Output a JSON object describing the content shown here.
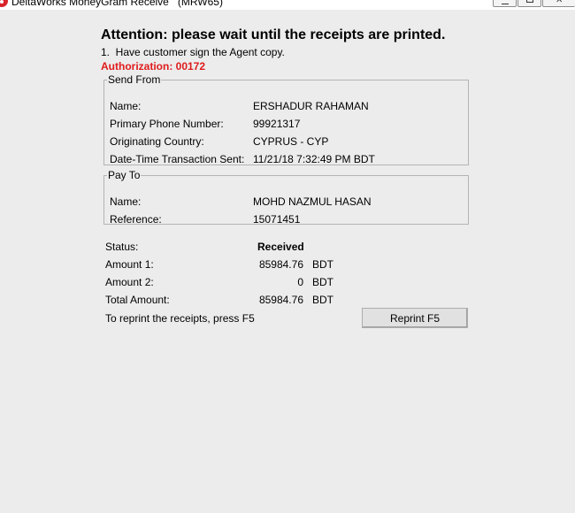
{
  "window": {
    "title": "DeltaWorks MoneyGram Receive   (MRW65)",
    "icon": "moneygram-logo-icon",
    "controls": [
      "minimize-icon",
      "maximize-icon",
      "close-icon"
    ]
  },
  "header": {
    "attention": "Attention: please wait until the receipts are printed.",
    "instruction": "1.  Have customer sign the Agent copy.",
    "authorization": "Authorization: 00172",
    "authorization_color": "#e01b1b"
  },
  "send_from": {
    "legend": "Send From",
    "rows": [
      {
        "label": "Name:",
        "value": "ERSHADUR RAHAMAN"
      },
      {
        "label": "Primary Phone Number:",
        "value": "99921317"
      },
      {
        "label": "Originating Country:",
        "value": "CYPRUS - CYP"
      },
      {
        "label": "Date-Time Transaction Sent:",
        "value": "11/21/18 7:32:49 PM BDT"
      }
    ]
  },
  "pay_to": {
    "legend": "Pay To",
    "rows": [
      {
        "label": "Name:",
        "value": "MOHD NAZMUL HASAN"
      },
      {
        "label": "Reference:",
        "value": "15071451"
      }
    ]
  },
  "summary": {
    "status_label": "Status:",
    "status_value": "Received",
    "amounts": [
      {
        "label": "Amount 1:",
        "amount": "85984.76",
        "currency": "BDT"
      },
      {
        "label": "Amount 2:",
        "amount": "0",
        "currency": "BDT"
      },
      {
        "label": "Total Amount:",
        "amount": "85984.76",
        "currency": "BDT"
      }
    ]
  },
  "reprint": {
    "note": "To reprint the receipts, press F5",
    "button_label": "Reprint F5"
  }
}
